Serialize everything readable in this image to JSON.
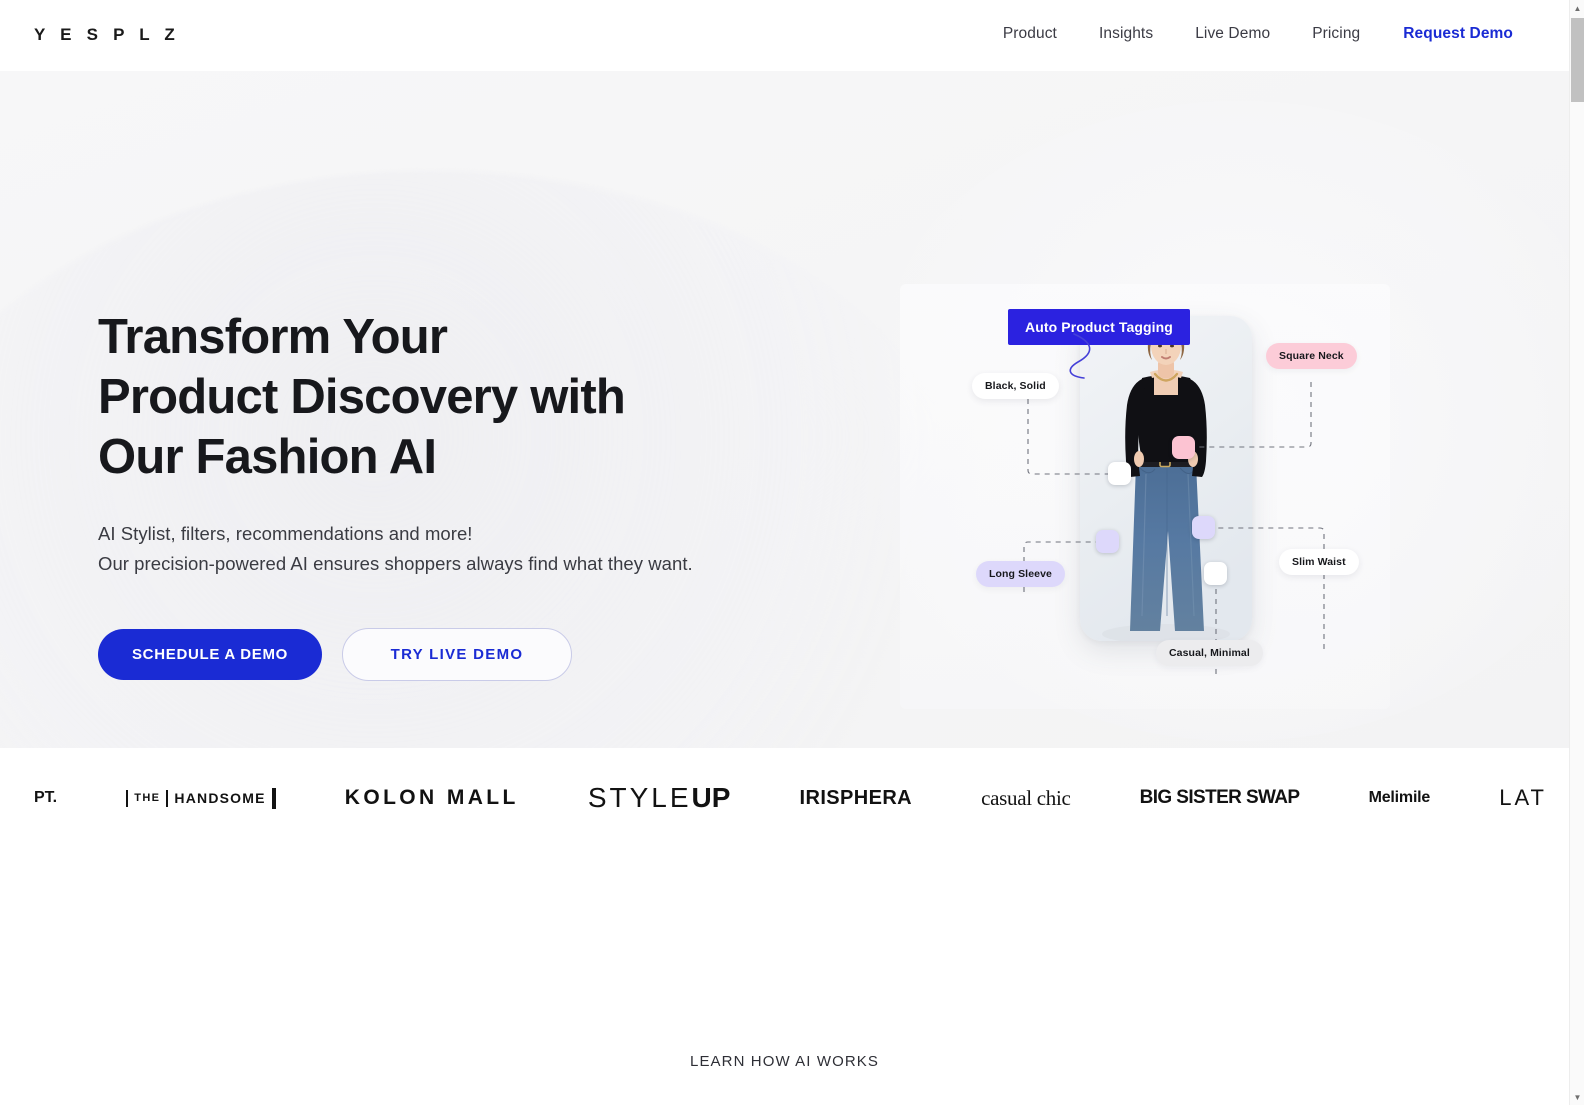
{
  "header": {
    "logo": "Y E S P L Z",
    "nav": [
      {
        "label": "Product",
        "cta": false
      },
      {
        "label": "Insights",
        "cta": false
      },
      {
        "label": "Live Demo",
        "cta": false
      },
      {
        "label": "Pricing",
        "cta": false
      },
      {
        "label": "Request Demo",
        "cta": true
      }
    ]
  },
  "hero": {
    "title_line1": "Transform Your",
    "title_line2": "Product Discovery with",
    "title_line3": "Our Fashion AI",
    "sub_line1": "AI Stylist, filters, recommendations and more!",
    "sub_line2": "Our precision-powered AI ensures shoppers always find what they want.",
    "primary_button": "SCHEDULE A DEMO",
    "secondary_button": "TRY LIVE DEMO",
    "banner_label": "Auto Product Tagging",
    "tags": {
      "black_solid": "Black, Solid",
      "square_neck": "Square Neck",
      "long_sleeve": "Long Sleeve",
      "slim_waist": "Slim Waist",
      "casual_minimal": "Casual, Minimal"
    }
  },
  "brands": [
    {
      "id": "pt",
      "label": "PT."
    },
    {
      "id": "handsome",
      "label": "THE",
      "label2": "HANDSOME"
    },
    {
      "id": "kolon-mall",
      "label": "KOLON MALL"
    },
    {
      "id": "styleup",
      "label": "STYLE",
      "label2": "UP"
    },
    {
      "id": "irisphera",
      "label": "IRISPHERA"
    },
    {
      "id": "casual-chic",
      "label": "casual chic"
    },
    {
      "id": "big-sister-swap",
      "label": "BIG SISTER SWAP"
    },
    {
      "id": "melimile",
      "label": "Melimile"
    },
    {
      "id": "lat",
      "label": "LAT"
    }
  ],
  "bottom": {
    "learn_link": "LEARN HOW AI WORKS"
  },
  "colors": {
    "accent_blue": "#1a2bd4",
    "banner_blue": "#2b22e0",
    "chip_pink": "#fcccd8",
    "chip_purple": "#ddd8fb",
    "chip_gray": "#ececee",
    "text_dark": "#17181c",
    "hero_bg": "#f5f5f6"
  }
}
